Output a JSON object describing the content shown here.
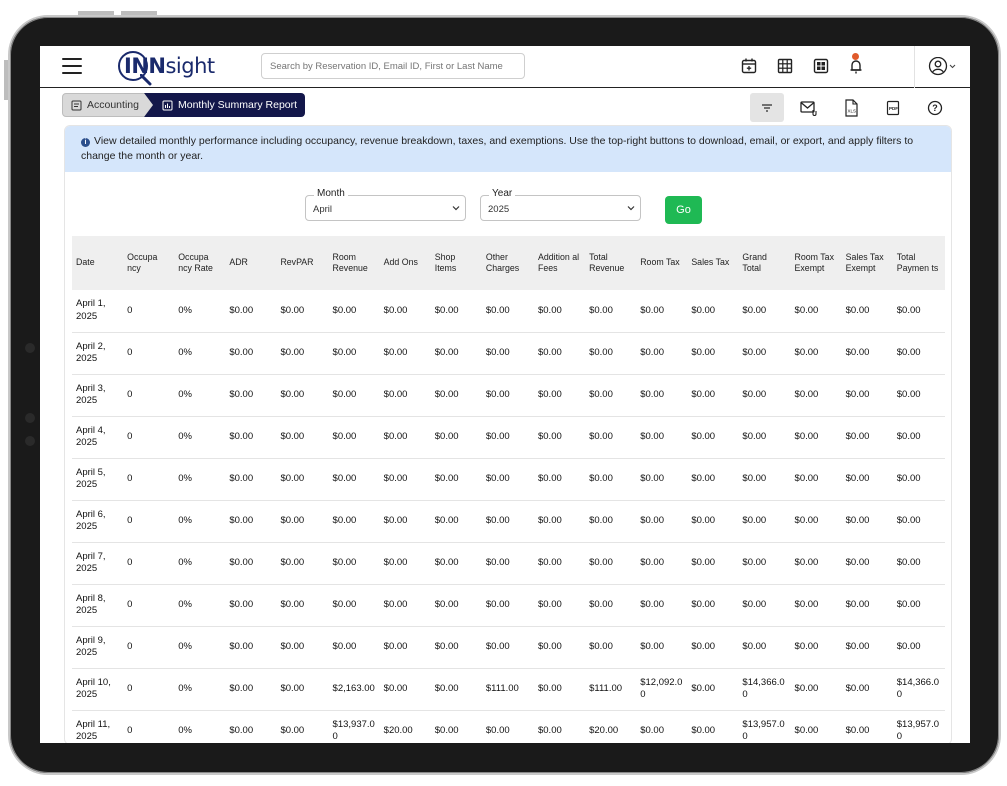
{
  "app": {
    "logo_bold": "INN",
    "logo_light": "sight",
    "search_placeholder": "Search by Reservation ID, Email ID, First or Last Name"
  },
  "breadcrumb": {
    "parent": "Accounting",
    "current": "Monthly Summary Report"
  },
  "info_text": "View detailed monthly performance including occupancy, revenue breakdown, taxes, and exemptions. Use the top-right buttons to download, email, or export, and apply filters to change the month or year.",
  "filters": {
    "month_label": "Month",
    "month_value": "April",
    "year_label": "Year",
    "year_value": "2025",
    "go_label": "Go"
  },
  "columns": [
    "Date",
    "Occupa ncy",
    "Occupa ncy Rate",
    "ADR",
    "RevPAR",
    "Room Revenue",
    "Add Ons",
    "Shop Items",
    "Other Charges",
    "Addition al Fees",
    "Total Revenue",
    "Room Tax",
    "Sales Tax",
    "Grand Total",
    "Room Tax Exempt",
    "Sales Tax Exempt",
    "Total Paymen ts"
  ],
  "rows": [
    [
      "April 1, 2025",
      "0",
      "0%",
      "$0.00",
      "$0.00",
      "$0.00",
      "$0.00",
      "$0.00",
      "$0.00",
      "$0.00",
      "$0.00",
      "$0.00",
      "$0.00",
      "$0.00",
      "$0.00",
      "$0.00",
      "$0.00"
    ],
    [
      "April 2, 2025",
      "0",
      "0%",
      "$0.00",
      "$0.00",
      "$0.00",
      "$0.00",
      "$0.00",
      "$0.00",
      "$0.00",
      "$0.00",
      "$0.00",
      "$0.00",
      "$0.00",
      "$0.00",
      "$0.00",
      "$0.00"
    ],
    [
      "April 3, 2025",
      "0",
      "0%",
      "$0.00",
      "$0.00",
      "$0.00",
      "$0.00",
      "$0.00",
      "$0.00",
      "$0.00",
      "$0.00",
      "$0.00",
      "$0.00",
      "$0.00",
      "$0.00",
      "$0.00",
      "$0.00"
    ],
    [
      "April 4, 2025",
      "0",
      "0%",
      "$0.00",
      "$0.00",
      "$0.00",
      "$0.00",
      "$0.00",
      "$0.00",
      "$0.00",
      "$0.00",
      "$0.00",
      "$0.00",
      "$0.00",
      "$0.00",
      "$0.00",
      "$0.00"
    ],
    [
      "April 5, 2025",
      "0",
      "0%",
      "$0.00",
      "$0.00",
      "$0.00",
      "$0.00",
      "$0.00",
      "$0.00",
      "$0.00",
      "$0.00",
      "$0.00",
      "$0.00",
      "$0.00",
      "$0.00",
      "$0.00",
      "$0.00"
    ],
    [
      "April 6, 2025",
      "0",
      "0%",
      "$0.00",
      "$0.00",
      "$0.00",
      "$0.00",
      "$0.00",
      "$0.00",
      "$0.00",
      "$0.00",
      "$0.00",
      "$0.00",
      "$0.00",
      "$0.00",
      "$0.00",
      "$0.00"
    ],
    [
      "April 7, 2025",
      "0",
      "0%",
      "$0.00",
      "$0.00",
      "$0.00",
      "$0.00",
      "$0.00",
      "$0.00",
      "$0.00",
      "$0.00",
      "$0.00",
      "$0.00",
      "$0.00",
      "$0.00",
      "$0.00",
      "$0.00"
    ],
    [
      "April 8, 2025",
      "0",
      "0%",
      "$0.00",
      "$0.00",
      "$0.00",
      "$0.00",
      "$0.00",
      "$0.00",
      "$0.00",
      "$0.00",
      "$0.00",
      "$0.00",
      "$0.00",
      "$0.00",
      "$0.00",
      "$0.00"
    ],
    [
      "April 9, 2025",
      "0",
      "0%",
      "$0.00",
      "$0.00",
      "$0.00",
      "$0.00",
      "$0.00",
      "$0.00",
      "$0.00",
      "$0.00",
      "$0.00",
      "$0.00",
      "$0.00",
      "$0.00",
      "$0.00",
      "$0.00"
    ],
    [
      "April 10, 2025",
      "0",
      "0%",
      "$0.00",
      "$0.00",
      "$2,163.00",
      "$0.00",
      "$0.00",
      "$111.00",
      "$0.00",
      "$111.00",
      "$12,092.0 0",
      "$0.00",
      "$14,366.0 0",
      "$0.00",
      "$0.00",
      "$14,366.0 0"
    ],
    [
      "April 11, 2025",
      "0",
      "0%",
      "$0.00",
      "$0.00",
      "$13,937.0 0",
      "$20.00",
      "$0.00",
      "$0.00",
      "$0.00",
      "$20.00",
      "$0.00",
      "$0.00",
      "$13,957.0 0",
      "$0.00",
      "$0.00",
      "$13,957.0 0"
    ]
  ]
}
